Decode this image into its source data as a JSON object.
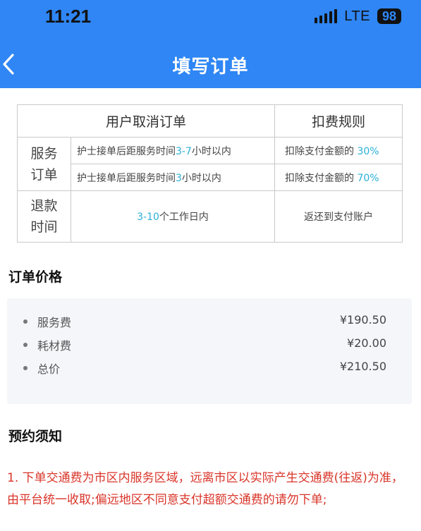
{
  "status_bar": {
    "time": "11:21",
    "network": "LTE",
    "battery": "98"
  },
  "header": {
    "back_icon": "chevron-left-icon",
    "title": "填写订单"
  },
  "rules_table": {
    "headers": [
      "用户取消订单",
      "扣费规则"
    ],
    "service_order_label": [
      "服务",
      "订单"
    ],
    "rows": [
      {
        "desc_pre": "护士接单后距服务时间",
        "desc_hl": "3-7",
        "desc_post": "小时以内",
        "fee_pre": "扣除支付金额的 ",
        "fee_hl": "30%"
      },
      {
        "desc_pre": "护士接单后距服务时间",
        "desc_hl": "3",
        "desc_post": "小时以内",
        "fee_pre": "扣除支付金额的 ",
        "fee_hl": "70%"
      }
    ],
    "refund_label": [
      "退款",
      "时间"
    ],
    "refund_time_hl": "3-10",
    "refund_time_post": "个工作日内",
    "refund_dest": "返还到支付账户"
  },
  "order_price": {
    "title": "订单价格",
    "items": [
      {
        "name": "服务费",
        "amount": "¥190.50"
      },
      {
        "name": "耗材费",
        "amount": "¥20.00"
      },
      {
        "name": "总价",
        "amount": "¥210.50"
      }
    ]
  },
  "booking_notice": {
    "title": "预约须知",
    "text": "1. 下单交通费为市区内服务区域，远离市区以实际产生交通费(往返)为准，由平台统一收取;偏远地区不同意支付超额交通费的请勿下单;"
  },
  "colors": {
    "primary": "#2f86f4",
    "highlight": "#2bb0d6",
    "notice": "#d9352a"
  }
}
